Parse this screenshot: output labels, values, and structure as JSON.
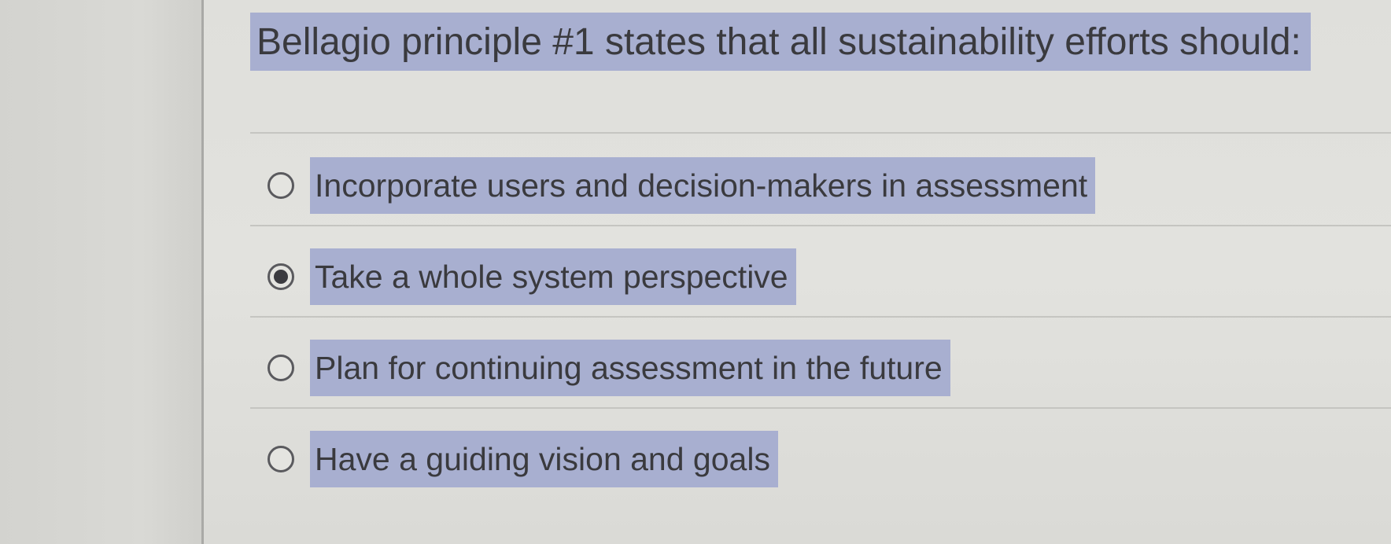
{
  "question": {
    "text": "Bellagio principle #1 states that all sustainability efforts should:"
  },
  "options": [
    {
      "label": "Incorporate users and decision-makers in assessment",
      "selected": false
    },
    {
      "label": "Take a whole system perspective",
      "selected": true
    },
    {
      "label": "Plan for continuing assessment in the future",
      "selected": false
    },
    {
      "label": "Have a guiding vision and goals",
      "selected": false
    }
  ],
  "colors": {
    "highlight": "#a8afd0",
    "text": "#3a3a3e",
    "background": "#e0e0dc"
  }
}
